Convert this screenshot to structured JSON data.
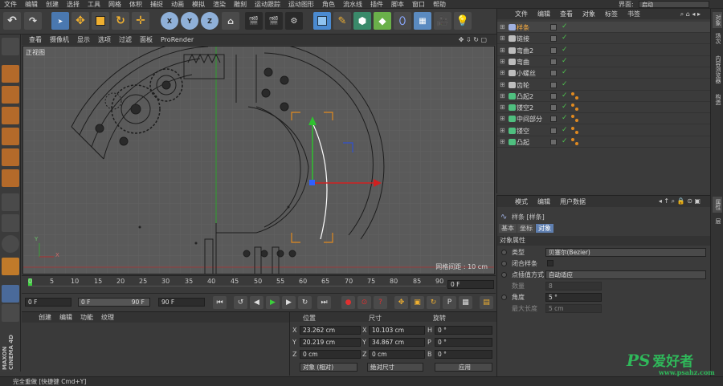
{
  "menubar": {
    "items": [
      "文件",
      "编辑",
      "创建",
      "选择",
      "工具",
      "网格",
      "体积",
      "捕捉",
      "动画",
      "模拟",
      "渲染",
      "雕刻",
      "运动跟踪",
      "运动图形",
      "角色",
      "流水线",
      "插件",
      "脚本",
      "窗口",
      "帮助"
    ],
    "layout_label": "界面:",
    "layout_value": "启动"
  },
  "toolbar": {
    "x": "X",
    "y": "Y",
    "z": "Z"
  },
  "viewport": {
    "menu": [
      "查看",
      "摄像机",
      "显示",
      "选项",
      "过滤",
      "面板",
      "ProRender"
    ],
    "view_name": "正视图",
    "grid_spacing": "网格间距 : 10 cm",
    "axis_y": "Y",
    "axis_x": "X"
  },
  "timeline": {
    "ticks": [
      "0",
      "5",
      "10",
      "15",
      "20",
      "25",
      "30",
      "35",
      "40",
      "45",
      "50",
      "55",
      "60",
      "65",
      "70",
      "75",
      "80",
      "85",
      "90"
    ],
    "current_frame": "0 F"
  },
  "playbar": {
    "start": "0 F",
    "range_start": "0 F",
    "range_end": "90 F",
    "end": "90 F"
  },
  "material": {
    "menu": [
      "创建",
      "编辑",
      "功能",
      "纹理"
    ]
  },
  "coords": {
    "col_position": "位置",
    "col_size": "尺寸",
    "col_rotation": "旋转",
    "x_label": "X",
    "y_label": "Y",
    "z_label": "Z",
    "px": "23.262 cm",
    "py": "20.219 cm",
    "pz": "0 cm",
    "sx": "10.103 cm",
    "sy": "34.867 cm",
    "sz": "0 cm",
    "h_label": "H",
    "p_label": "P",
    "b_label": "B",
    "h": "0 °",
    "p": "0 °",
    "b": "0 °",
    "mode": "对象 (相对)",
    "size_mode": "绝对尺寸",
    "apply": "应用"
  },
  "objects": {
    "menu": [
      "文件",
      "编辑",
      "查看",
      "对象",
      "标签",
      "书签"
    ],
    "rows": [
      {
        "name": "样条",
        "icon": "spline-icon",
        "color": "#9fb0e0",
        "selected": true
      },
      {
        "name": "链接",
        "icon": "null-icon",
        "color": "#bdbdbd"
      },
      {
        "name": "弯曲2",
        "icon": "null-icon",
        "color": "#bdbdbd"
      },
      {
        "name": "弯曲",
        "icon": "null-icon",
        "color": "#bdbdbd"
      },
      {
        "name": "小螺丝",
        "icon": "null-icon",
        "color": "#bdbdbd"
      },
      {
        "name": "齿轮",
        "icon": "null-icon",
        "color": "#bdbdbd"
      },
      {
        "name": "凸起2",
        "icon": "extrude-icon",
        "color": "#4fbf7f"
      },
      {
        "name": "镂空2",
        "icon": "extrude-icon",
        "color": "#4fbf7f"
      },
      {
        "name": "中间部分",
        "icon": "extrude-icon",
        "color": "#4fbf7f"
      },
      {
        "name": "镂空",
        "icon": "extrude-icon",
        "color": "#4fbf7f"
      },
      {
        "name": "凸起",
        "icon": "extrude-icon",
        "color": "#4fbf7f"
      }
    ]
  },
  "attributes": {
    "menu": [
      "模式",
      "编辑",
      "用户数据"
    ],
    "object_title": "样条 [样条]",
    "tabs": [
      "基本",
      "坐标",
      "对象"
    ],
    "section": "对象属性",
    "type_label": "类型",
    "type_value": "贝塞尔(Bezier)",
    "closed_label": "闭合样条",
    "interp_label": "点插值方式",
    "interp_value": "自动适应",
    "count_label": "数量",
    "count_value": "8",
    "angle_label": "角度",
    "angle_value": "5 °",
    "maxlen_label": "最大长度",
    "maxlen_value": "5 cm"
  },
  "right_tabs": [
    "对象",
    "场次",
    "内容浏览器",
    "构造"
  ],
  "right_tabs_bottom": [
    "属性",
    "层"
  ],
  "status": "完全重做 [快捷键 Cmd+Y]",
  "watermark": {
    "brand": "PS",
    "text": "爱好者",
    "url": "www.psahz.com"
  }
}
